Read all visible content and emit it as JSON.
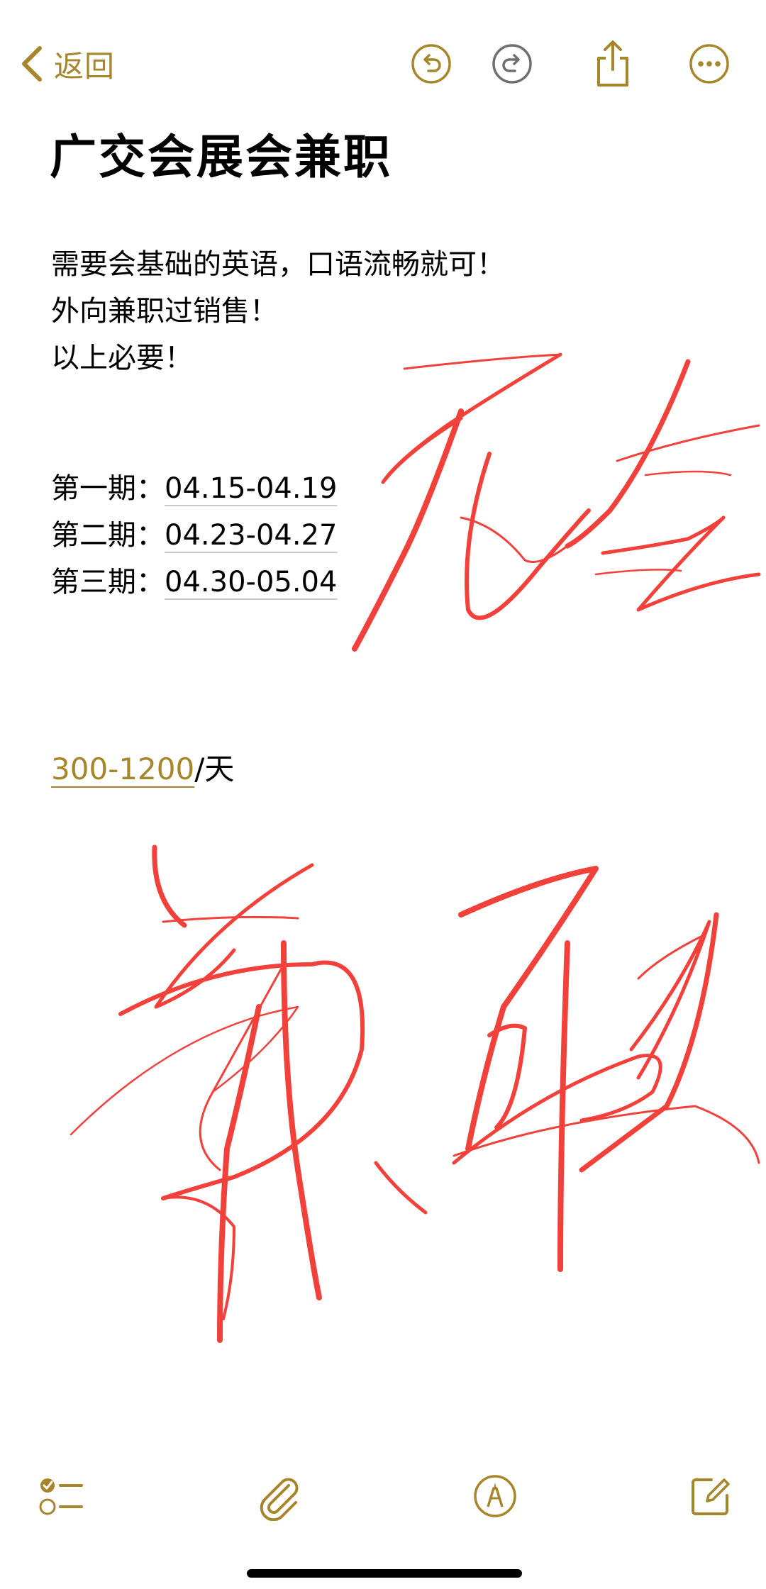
{
  "nav": {
    "back_label": "返回",
    "back_icon": "chevron-left-icon",
    "undo_icon": "undo-icon",
    "redo_icon": "redo-icon",
    "share_icon": "share-icon",
    "more_icon": "ellipsis-icon"
  },
  "note": {
    "title": "广交会展会兼职",
    "lines": [
      "需要会基础的英语，口语流畅就可！",
      "外向兼职过销售！",
      "以上必要！"
    ],
    "periods": [
      {
        "label": "第一期：",
        "date": "04.15-04.19"
      },
      {
        "label": "第二期：",
        "date": "04.23-04.27"
      },
      {
        "label": "第三期：",
        "date": "04.30-05.04"
      }
    ],
    "pay": {
      "amount": "300-1200",
      "unit": "/天"
    }
  },
  "toolbar": {
    "checklist_icon": "checklist-icon",
    "attachment_icon": "paperclip-icon",
    "markup_icon": "markup-pen-icon",
    "compose_icon": "compose-icon"
  },
  "colors": {
    "accent": "#A7862B",
    "ink": "#F2413A",
    "text": "#000000",
    "background": "#FFFFFF"
  }
}
